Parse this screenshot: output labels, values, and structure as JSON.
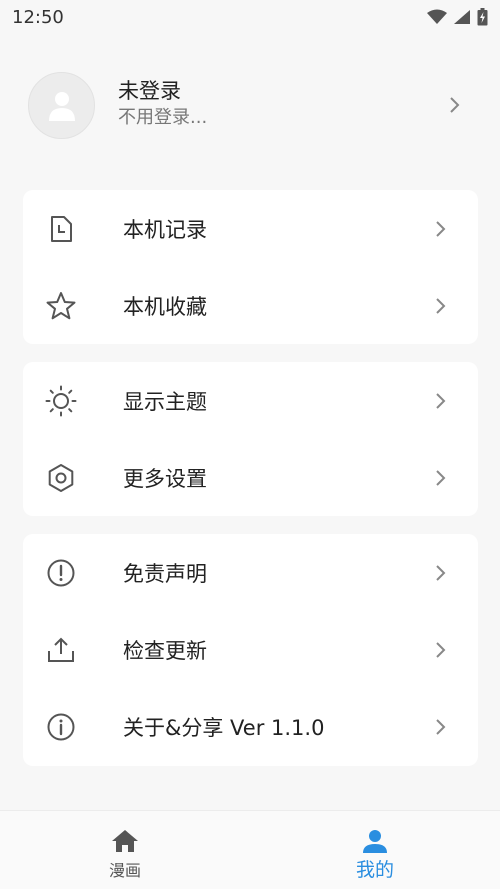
{
  "status_bar": {
    "time": "12:50",
    "icons": [
      "wifi-icon",
      "signal-icon",
      "battery-icon"
    ]
  },
  "profile": {
    "name": "未登录",
    "subtitle": "不用登录..."
  },
  "groups": [
    {
      "items": [
        {
          "label": "本机记录",
          "icon": "history-file-icon"
        },
        {
          "label": "本机收藏",
          "icon": "star-icon"
        }
      ]
    },
    {
      "items": [
        {
          "label": "显示主题",
          "icon": "sun-icon"
        },
        {
          "label": "更多设置",
          "icon": "settings-hexagon-icon"
        }
      ]
    },
    {
      "items": [
        {
          "label": "免责声明",
          "icon": "alert-circle-icon"
        },
        {
          "label": "检查更新",
          "icon": "upload-icon"
        },
        {
          "label": "关于&分享 Ver 1.1.0",
          "icon": "info-circle-icon"
        }
      ]
    }
  ],
  "bottom_nav": {
    "items": [
      {
        "label": "漫画",
        "icon": "home-icon",
        "active": false
      },
      {
        "label": "我的",
        "icon": "person-icon",
        "active": true
      }
    ]
  },
  "colors": {
    "accent": "#2a8ee0",
    "background": "#f7f7f7",
    "card": "#ffffff",
    "icon": "#555555",
    "chevron": "#888888"
  }
}
